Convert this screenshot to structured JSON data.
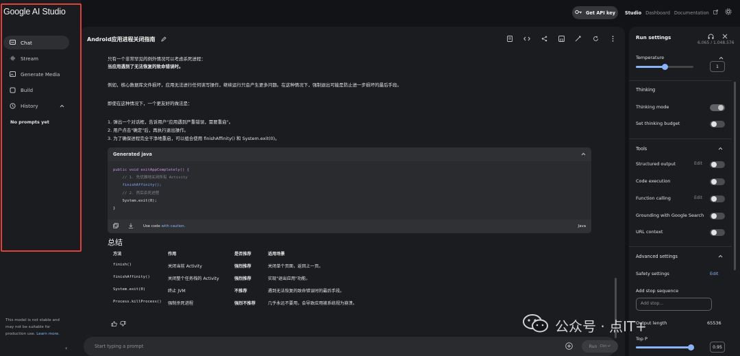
{
  "app": {
    "brand": "Google AI Studio"
  },
  "topbar": {
    "api_key_label": "Get API key",
    "studio": "Studio",
    "dashboard": "Dashboard",
    "documentation": "Documentation"
  },
  "sidebar": {
    "items": [
      {
        "label": "Chat"
      },
      {
        "label": "Stream"
      },
      {
        "label": "Generate Media"
      },
      {
        "label": "Build"
      },
      {
        "label": "History"
      }
    ],
    "no_prompts": "No prompts yet",
    "note": "This model is not stable and may not be suitable for production use.",
    "learn_more": "Learn more."
  },
  "chat": {
    "title": "Android应用进程关闭指南",
    "messages": [
      "只有一个非常罕见的例外情况可以考虑杀死进程：",
      "当应用遇到了无法恢复的致命错误时。",
      "例如，核心数据库文件损坏，应用无法进行任何读写操作，继续运行只会产生更多问题。在这种情况下，强制退出可能是防止进一步损坏的最后手段。",
      "即使在这种情况下，一个更友好的做法是：",
      "1. 弹出一个对话框，告诉用户\"应用遇到严重错误，需要重启\"。",
      "2. 用户点击\"确定\"后，再执行退出操作。",
      "3. 为了确保进程完全干净地重启，可以组合使用 finishAffinity() 和 System.exit(0)。"
    ],
    "code_block": {
      "title": "Generated java",
      "lines": [
        "public void exitAppCompletely() {",
        "    // 1. 先优雅地关闭所有 Activity",
        "    finishAffinity();",
        "    // 2. 然后杀死进程",
        "    System.exit(0);",
        "}"
      ],
      "footer_text": "Use code",
      "footer_link": "with caution.",
      "language": "Java"
    },
    "summary_title": "总结",
    "table": {
      "headers": [
        "方法",
        "作用",
        "是否推荐",
        "适用场景"
      ],
      "rows": [
        [
          "finish()",
          "关闭当前 Activity",
          "强烈推荐",
          "关闭单个页面，返回上一页。"
        ],
        [
          "finishAffinity()",
          "关闭整个任务栈的 Activity",
          "强烈推荐",
          "实现\"退出应用\"功能。"
        ],
        [
          "System.exit(0)",
          "终止 JVM",
          "不推荐",
          "遇到无法恢复的致命错误时的最后手段。"
        ],
        [
          "Process.killProcess()",
          "强制杀死进程",
          "强烈不推荐",
          "几乎永远不要用，会导致应用被系统视为崩溃。"
        ]
      ]
    },
    "prompt_placeholder": "Start typing a prompt",
    "run_label": "Run",
    "run_shortcut": "Ctrl ↵"
  },
  "watermark": {
    "text": "公众号 · 点IT+"
  },
  "settings": {
    "title": "Run settings",
    "token_count": "6,065 / 1,048,576",
    "temperature_label": "Temperature",
    "temperature_value": "1",
    "temperature_level": 0.5,
    "thinking": "Thinking",
    "thinking_mode": "Thinking mode",
    "thinking_budget": "Set thinking budget",
    "tools": "Tools",
    "structured_output": "Structured output",
    "code_execution": "Code execution",
    "function_calling": "Function calling",
    "grounding": "Grounding with Google Search",
    "url_context": "URL context",
    "edit": "Edit",
    "advanced": "Advanced settings",
    "safety": "Safety settings",
    "safety_edit": "Edit",
    "stop_sequence": "Add stop sequence",
    "stop_placeholder": "Add stop...",
    "output_length": "Output length",
    "output_length_value": "65536",
    "top_p": "Top P",
    "top_p_value": "0.95",
    "top_p_level": 0.95
  },
  "colors": {
    "accent": "#8ab4f8",
    "highlight_border": "#e0413b"
  }
}
